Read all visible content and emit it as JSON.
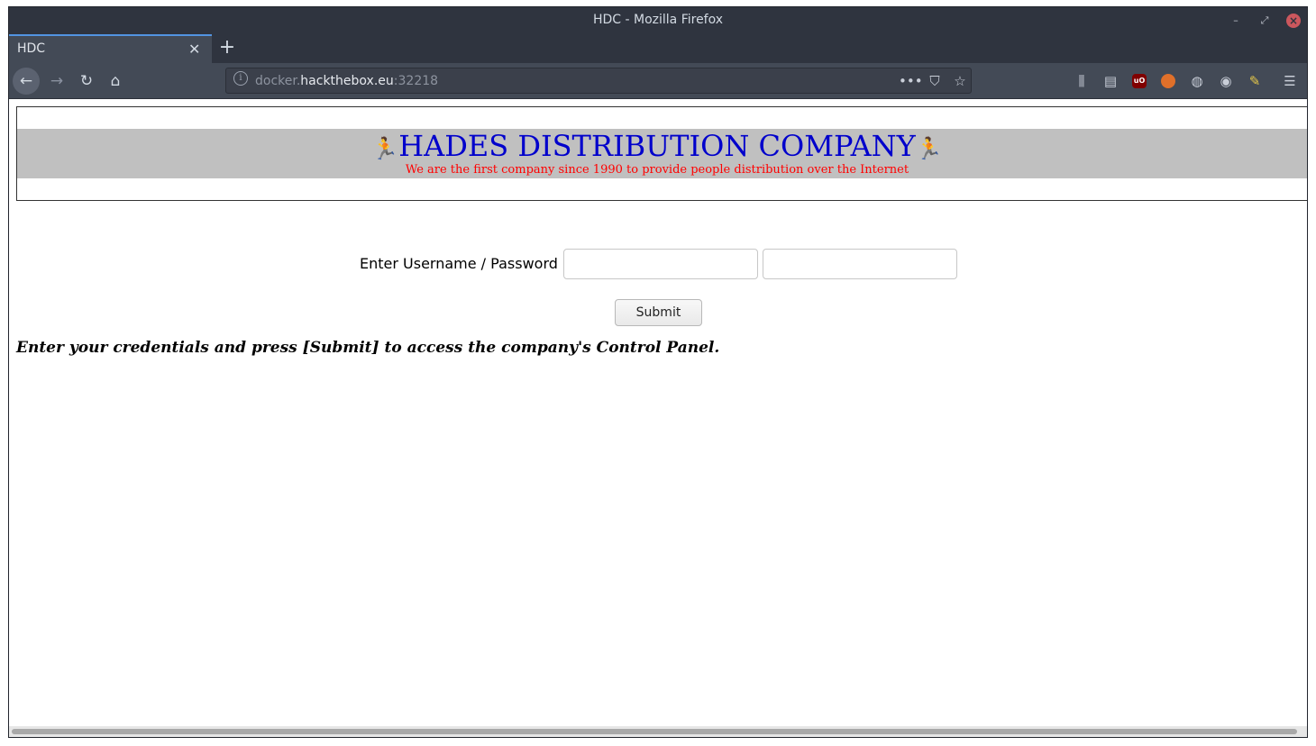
{
  "window": {
    "title": "HDC - Mozilla Firefox"
  },
  "tab": {
    "title": "HDC"
  },
  "url": {
    "scheme_host_prefix": "docker.",
    "host": "hackthebox.eu",
    "port": ":32218"
  },
  "page": {
    "company_name": "HADES DISTRIBUTION COMPANY",
    "slogan": "We are the first company since 1990 to provide people distribution over the Internet",
    "login_label": "Enter Username / Password",
    "username_value": "",
    "password_value": "",
    "submit_label": "Submit",
    "hint": "Enter your credentials and press [Submit] to access the company's Control Panel."
  },
  "colors": {
    "company_name": "#0000cc",
    "slogan": "#ff0000",
    "banner_bg": "#c0c0c0",
    "runner_icon": "#f2a535"
  },
  "icons": [
    "back-arrow-icon",
    "forward-arrow-icon",
    "reload-icon",
    "home-icon",
    "site-info-icon",
    "page-actions-icon",
    "pocket-icon",
    "bookmark-star-icon",
    "library-icon",
    "sidebar-icon",
    "ublock-icon",
    "extension-icon",
    "palette-icon",
    "account-icon",
    "brush-icon",
    "menu-icon",
    "runner-icon"
  ]
}
